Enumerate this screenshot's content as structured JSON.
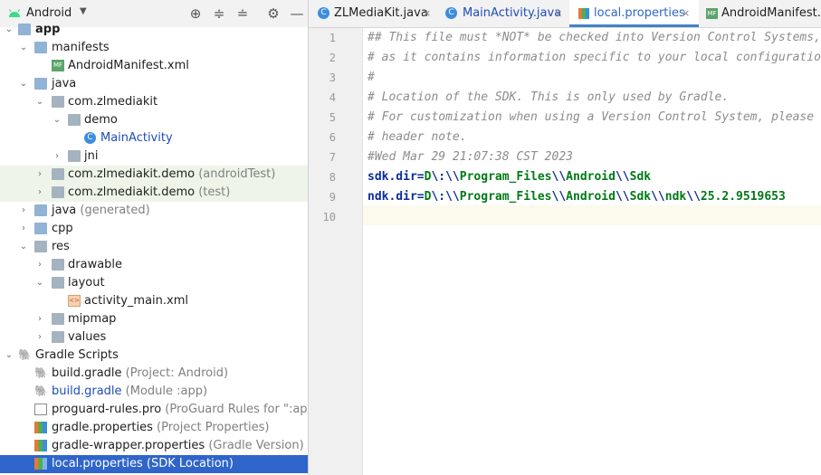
{
  "project_panel": {
    "view_label": "Android",
    "tree": [
      {
        "label": "app",
        "secondary": ""
      },
      {
        "label": "manifests",
        "secondary": ""
      },
      {
        "label": "AndroidManifest.xml",
        "secondary": ""
      },
      {
        "label": "java",
        "secondary": ""
      },
      {
        "label": "com.zlmediakit",
        "secondary": ""
      },
      {
        "label": "demo",
        "secondary": ""
      },
      {
        "label": "MainActivity",
        "secondary": ""
      },
      {
        "label": "jni",
        "secondary": ""
      },
      {
        "label": "com.zlmediakit.demo",
        "secondary": "(androidTest)"
      },
      {
        "label": "com.zlmediakit.demo",
        "secondary": "(test)"
      },
      {
        "label": "java",
        "secondary": "(generated)"
      },
      {
        "label": "cpp",
        "secondary": ""
      },
      {
        "label": "res",
        "secondary": ""
      },
      {
        "label": "drawable",
        "secondary": ""
      },
      {
        "label": "layout",
        "secondary": ""
      },
      {
        "label": "activity_main.xml",
        "secondary": ""
      },
      {
        "label": "mipmap",
        "secondary": ""
      },
      {
        "label": "values",
        "secondary": ""
      },
      {
        "label": "Gradle Scripts",
        "secondary": ""
      },
      {
        "label": "build.gradle",
        "secondary": "(Project: Android)"
      },
      {
        "label": "build.gradle",
        "secondary": "(Module :app)"
      },
      {
        "label": "proguard-rules.pro",
        "secondary": "(ProGuard Rules for \":app\")"
      },
      {
        "label": "gradle.properties",
        "secondary": "(Project Properties)"
      },
      {
        "label": "gradle-wrapper.properties",
        "secondary": "(Gradle Version)"
      },
      {
        "label": "local.properties",
        "secondary": "(SDK Location)"
      }
    ]
  },
  "tabs": [
    {
      "label": "ZLMediaKit.java",
      "close": "×"
    },
    {
      "label": "MainActivity.java",
      "close": "×"
    },
    {
      "label": "local.properties",
      "close": "×"
    },
    {
      "label": "AndroidManifest.xml",
      "close": ""
    }
  ],
  "editor": {
    "line_numbers": [
      "1",
      "2",
      "3",
      "4",
      "5",
      "6",
      "7",
      "8",
      "9",
      "10"
    ],
    "comments": [
      "## This file must *NOT* be checked into Version Control Systems,",
      "# as it contains information specific to your local configuration.",
      "#",
      "# Location of the SDK. This is only used by Gradle.",
      "# For customization when using a Version Control System, please read the",
      "# header note.",
      "#Wed Mar 29 21:07:38 CST 2023"
    ],
    "line8": {
      "key": "sdk.dir",
      "eq": "=",
      "p1": "D",
      "e1": "\\:\\\\",
      "p2": "Program_Files",
      "e2": "\\\\",
      "p3": "Android",
      "e3": "\\\\",
      "p4": "Sdk"
    },
    "line9": {
      "key": "ndk.dir",
      "eq": "=",
      "p1": "D",
      "e1": "\\:\\\\",
      "p2": "Program_Files",
      "e2": "\\\\",
      "p3": "Android",
      "e3": "\\\\",
      "p4": "Sdk",
      "e4": "\\\\",
      "p5": "ndk",
      "e5": "\\\\",
      "p6": "25.2.9519653"
    }
  },
  "colors": {
    "selection": "#2f65ca",
    "test_highlight": "#eef5e8",
    "tab_underline": "#4083c9"
  }
}
